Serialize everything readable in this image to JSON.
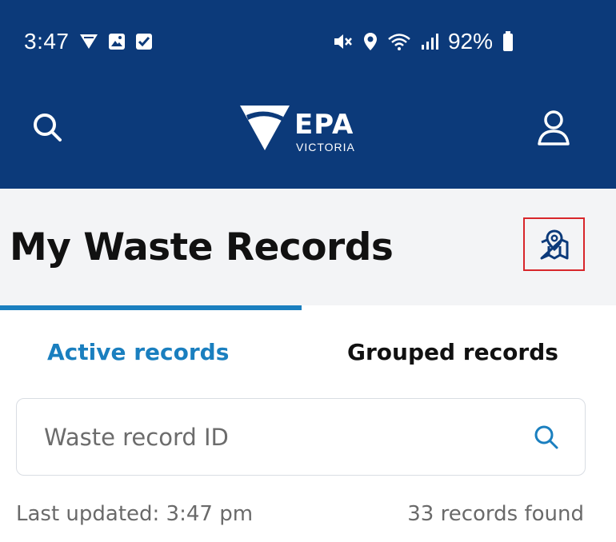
{
  "status_bar": {
    "time": "3:47",
    "battery_percent": "92%",
    "left_icons": [
      "signal-triangle-icon",
      "image-icon",
      "checkbox-icon"
    ],
    "right_icons": [
      "mute-icon",
      "location-icon",
      "wifi-icon",
      "cell-signal-icon",
      "battery-icon"
    ]
  },
  "header": {
    "logo_title": "EPA",
    "logo_subtitle": "VICTORIA",
    "background_color": "#0c3a7a"
  },
  "page": {
    "title": "My Waste Records",
    "map_button_icon": "map-pin-icon"
  },
  "tabs": [
    {
      "label": "Active records",
      "active": true
    },
    {
      "label": "Grouped records",
      "active": false
    }
  ],
  "search": {
    "placeholder": "Waste record ID",
    "value": ""
  },
  "footer_info": {
    "last_updated": "Last updated: 3:47 pm",
    "records_found": "33 records found"
  },
  "colors": {
    "accent": "#1a7fbf",
    "highlight_border": "#d8262b",
    "title_band": "#f3f4f6"
  }
}
